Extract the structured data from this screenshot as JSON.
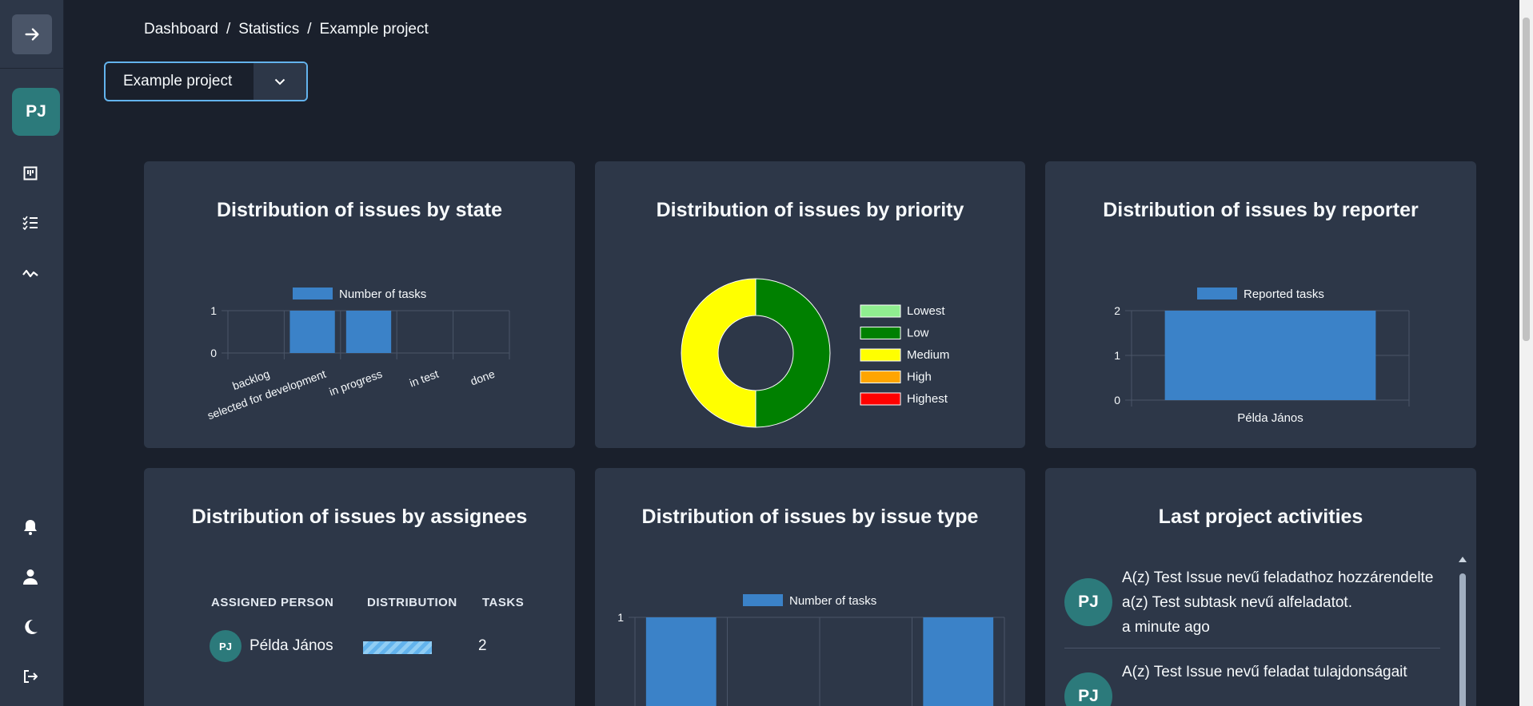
{
  "sidebar": {
    "collapse_icon": "arrow-right-icon",
    "avatar_initials": "PJ",
    "nav_icons": [
      "board-icon",
      "checklist-icon",
      "statistics-icon"
    ],
    "bottom_icons": [
      "bell-icon",
      "user-icon",
      "moon-icon",
      "logout-icon"
    ]
  },
  "breadcrumb": {
    "items": [
      "Dashboard",
      "Statistics",
      "Example project"
    ],
    "separator": "/"
  },
  "project_select": {
    "value": "Example project"
  },
  "cards": {
    "state": {
      "title": "Distribution of issues by state"
    },
    "priority": {
      "title": "Distribution of issues by priority"
    },
    "reporter": {
      "title": "Distribution of issues by reporter"
    },
    "assignees": {
      "title": "Distribution of issues by assignees",
      "headers": {
        "person": "ASSIGNED PERSON",
        "distribution": "DISTRIBUTION",
        "tasks": "TASKS"
      },
      "rows": [
        {
          "initials": "PJ",
          "name": "Példa János",
          "distribution": 1,
          "tasks": "2"
        }
      ]
    },
    "issue_type": {
      "title": "Distribution of issues by issue type"
    },
    "activities": {
      "title": "Last project activities",
      "items": [
        {
          "initials": "PJ",
          "text": "A(z) Test Issue nevű feladathoz hozzárendelte a(z) Test subtask nevű alfeladatot.",
          "time": "a minute ago"
        },
        {
          "initials": "PJ",
          "text": "A(z) Test Issue nevű feladat tulajdonságait",
          "time": ""
        }
      ]
    }
  },
  "chart_data": [
    {
      "type": "bar",
      "categories": [
        "backlog",
        "selected for development",
        "in progress",
        "in test",
        "done"
      ],
      "series": [
        {
          "name": "Number of tasks",
          "values": [
            0,
            1,
            1,
            0,
            0
          ]
        }
      ],
      "ylim": [
        0,
        1
      ],
      "yticks": [
        0,
        1
      ],
      "color": "#3b82c8",
      "grid": true,
      "legend": "top"
    },
    {
      "type": "pie",
      "categories": [
        "Lowest",
        "Low",
        "Medium",
        "High",
        "Highest"
      ],
      "values": [
        0,
        1,
        1,
        0,
        0
      ],
      "colors": [
        "#90ee90",
        "#008000",
        "#ffff00",
        "#ffa500",
        "#ff0000"
      ],
      "legend": "right"
    },
    {
      "type": "bar",
      "categories": [
        "Példa János"
      ],
      "series": [
        {
          "name": "Reported tasks",
          "values": [
            2
          ]
        }
      ],
      "ylim": [
        0,
        2
      ],
      "yticks": [
        0,
        1,
        2
      ],
      "color": "#3b82c8",
      "grid": true,
      "legend": "top"
    },
    {
      "type": "bar",
      "categories": [
        "",
        "",
        "",
        ""
      ],
      "series": [
        {
          "name": "Number of tasks",
          "values": [
            1,
            0,
            0,
            1
          ]
        }
      ],
      "ylim": [
        0,
        1
      ],
      "yticks": [
        1
      ],
      "color": "#3b82c8",
      "grid": true,
      "legend": "top"
    }
  ]
}
